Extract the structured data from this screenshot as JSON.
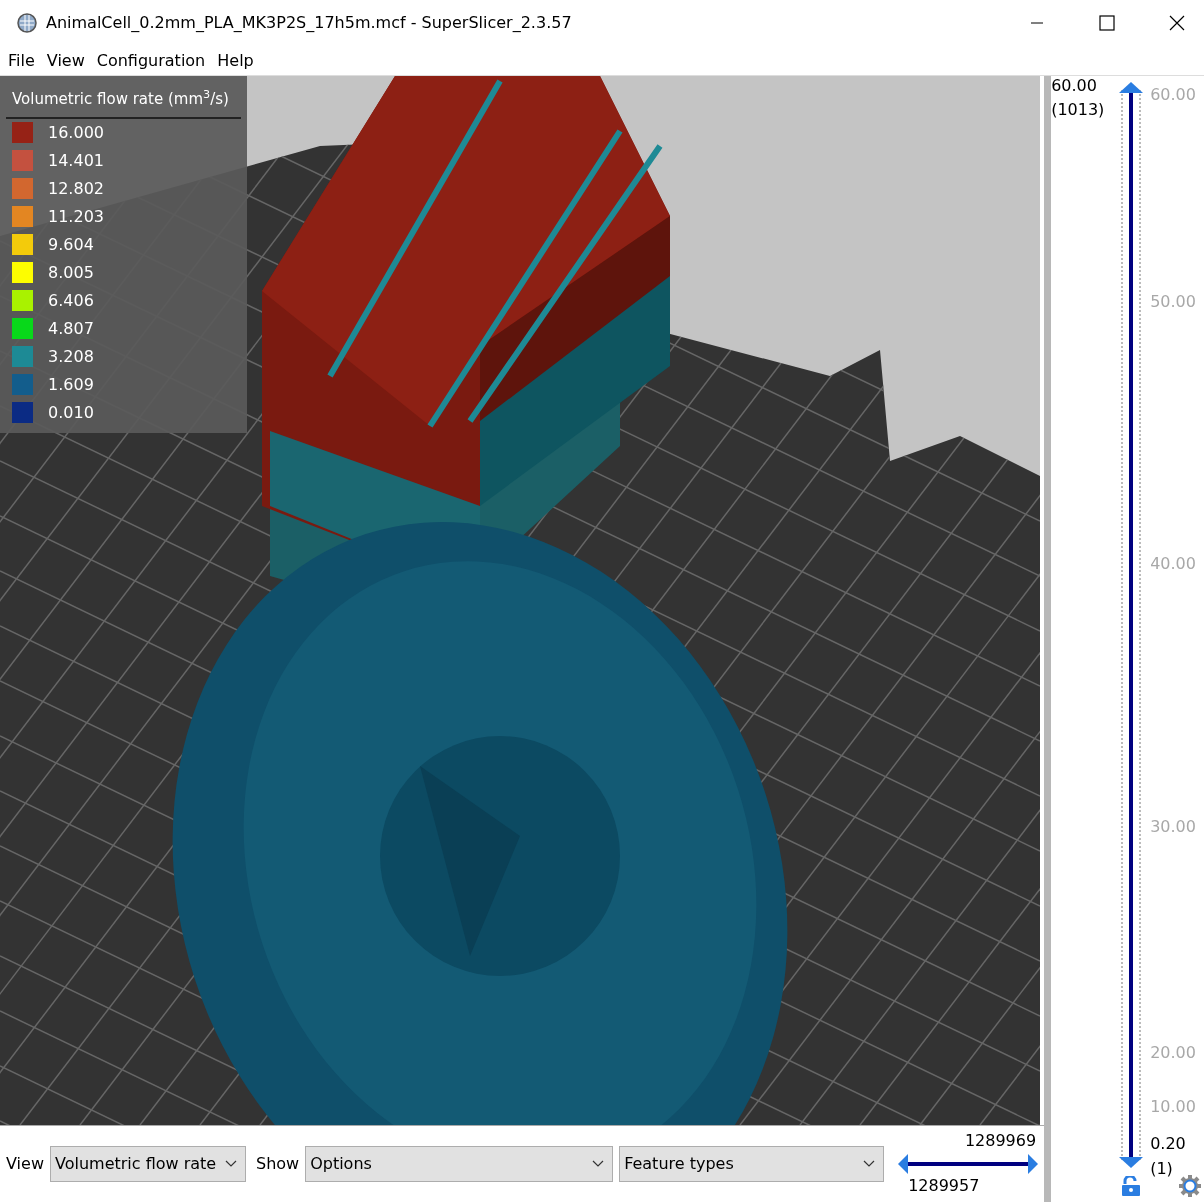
{
  "window": {
    "title": "AnimalCell_0.2mm_PLA_MK3P2S_17h5m.mcf - SuperSlicer_2.3.57"
  },
  "menu": [
    "File",
    "View",
    "Configuration",
    "Help"
  ],
  "legend": {
    "title": "Volumetric flow rate (mm$^{3}$/s)",
    "items": [
      {
        "value": "16.000",
        "color": "#962216"
      },
      {
        "value": "14.401",
        "color": "#c4513f"
      },
      {
        "value": "12.802",
        "color": "#d2672f"
      },
      {
        "value": "11.203",
        "color": "#e38622"
      },
      {
        "value": "9.604",
        "color": "#f3cb0b"
      },
      {
        "value": "8.005",
        "color": "#fdfd00"
      },
      {
        "value": "6.406",
        "color": "#a9f200"
      },
      {
        "value": "4.807",
        "color": "#08d81a"
      },
      {
        "value": "3.208",
        "color": "#1d8a95"
      },
      {
        "value": "1.609",
        "color": "#135d8c"
      },
      {
        "value": "0.010",
        "color": "#0b2b84"
      }
    ]
  },
  "layer_slider": {
    "upper_value": "60.00",
    "upper_layer": "(1013)",
    "lower_value": "0.20",
    "lower_layer": "(1)",
    "upper_thumb": {
      "level": 1
    },
    "lower_thumb": {
      "level": 0
    },
    "ticks": [
      "60.00",
      "50.00",
      "40.00",
      "30.00",
      "20.00",
      "10.00"
    ]
  },
  "bottom_bar": {
    "view_label": "View",
    "view_value": "Volumetric flow rate",
    "show_label": "Show",
    "show_value": "Options",
    "feature_value": "Feature types"
  },
  "move_slider": {
    "upper_value": "1289969",
    "lower_value": "1289957",
    "upper_thumb": {
      "level": 1
    },
    "lower_thumb": {
      "level": 0
    }
  }
}
